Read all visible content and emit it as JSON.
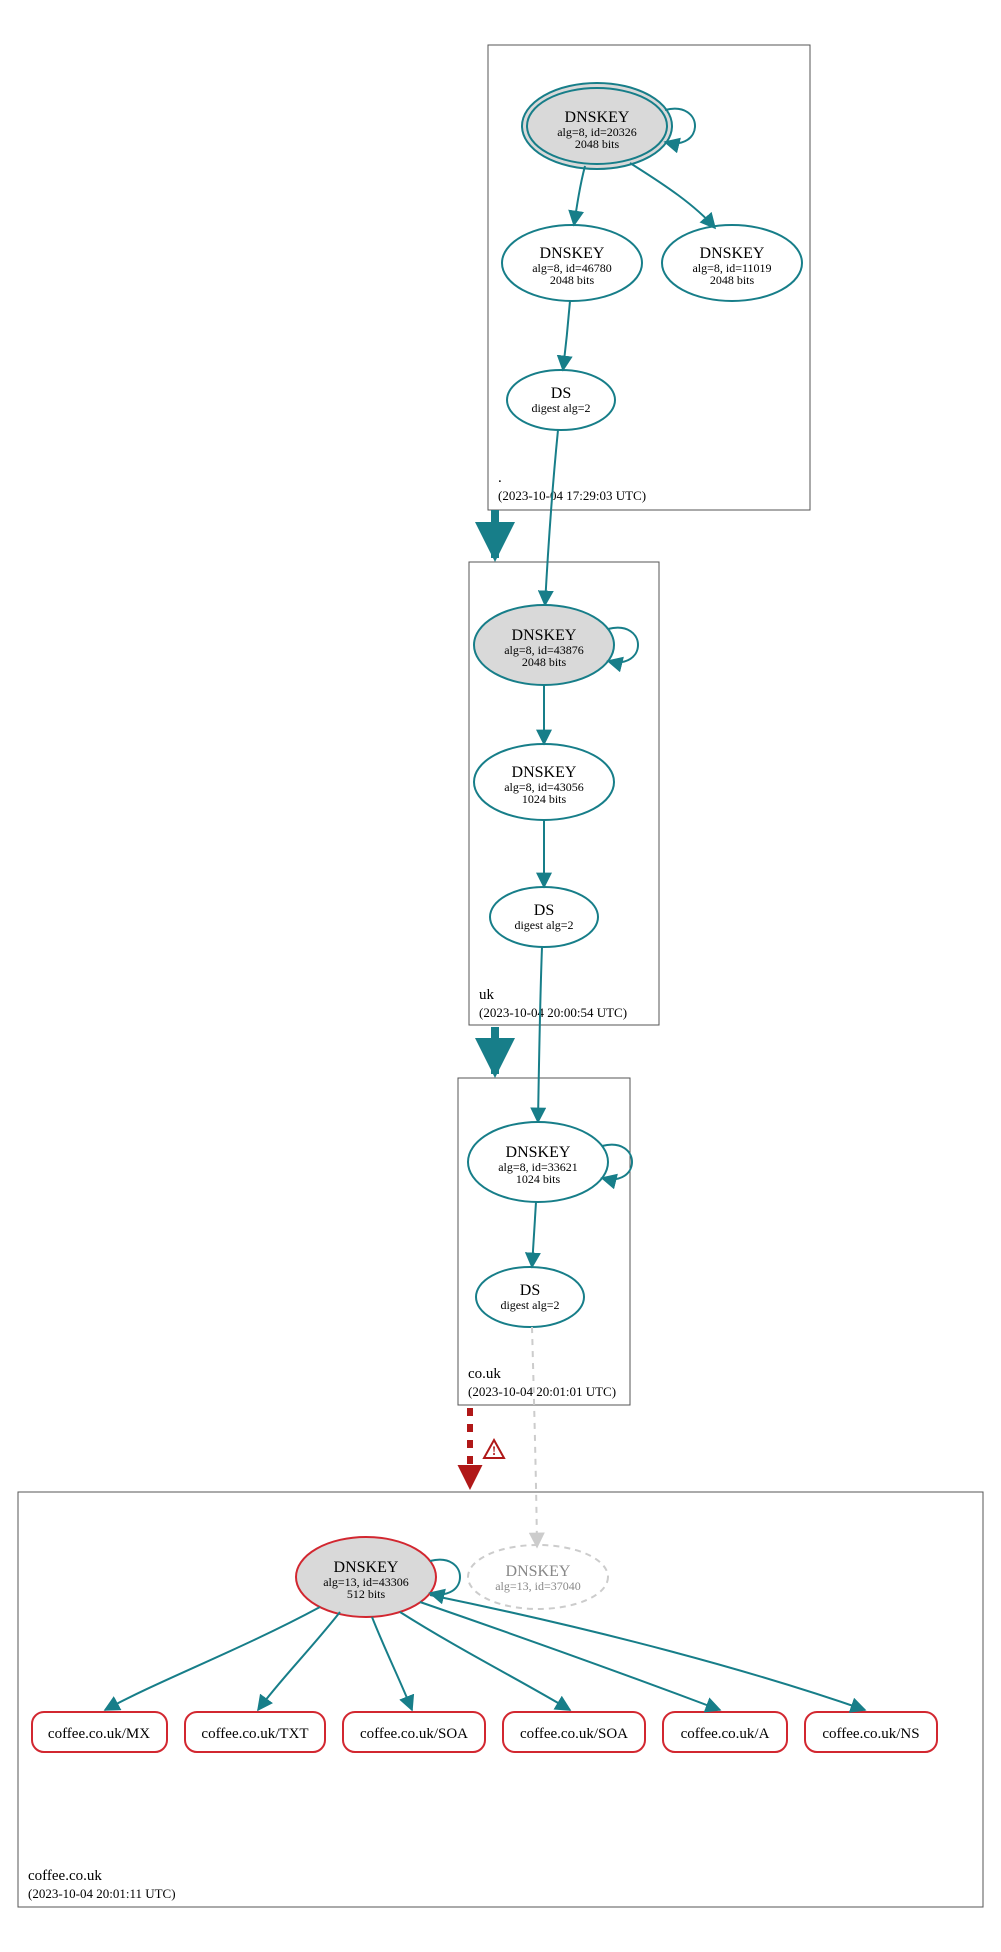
{
  "colors": {
    "teal": "#177e89",
    "red": "#d22730",
    "gray": "#cccccc",
    "fill_gray": "#d9d9d9"
  },
  "zones": {
    "root": {
      "name": ".",
      "timestamp": "(2023-10-04 17:29:03 UTC)"
    },
    "uk": {
      "name": "uk",
      "timestamp": "(2023-10-04 20:00:54 UTC)"
    },
    "couk": {
      "name": "co.uk",
      "timestamp": "(2023-10-04 20:01:01 UTC)"
    },
    "coffee": {
      "name": "coffee.co.uk",
      "timestamp": "(2023-10-04 20:01:11 UTC)"
    }
  },
  "nodes": {
    "root_ksk": {
      "title": "DNSKEY",
      "line2": "alg=8, id=20326",
      "line3": "2048 bits"
    },
    "root_zsk1": {
      "title": "DNSKEY",
      "line2": "alg=8, id=46780",
      "line3": "2048 bits"
    },
    "root_zsk2": {
      "title": "DNSKEY",
      "line2": "alg=8, id=11019",
      "line3": "2048 bits"
    },
    "root_ds": {
      "title": "DS",
      "line2": "digest alg=2"
    },
    "uk_ksk": {
      "title": "DNSKEY",
      "line2": "alg=8, id=43876",
      "line3": "2048 bits"
    },
    "uk_zsk": {
      "title": "DNSKEY",
      "line2": "alg=8, id=43056",
      "line3": "1024 bits"
    },
    "uk_ds": {
      "title": "DS",
      "line2": "digest alg=2"
    },
    "couk_ksk": {
      "title": "DNSKEY",
      "line2": "alg=8, id=33621",
      "line3": "1024 bits"
    },
    "couk_ds": {
      "title": "DS",
      "line2": "digest alg=2"
    },
    "coffee_ksk": {
      "title": "DNSKEY",
      "line2": "alg=13, id=43306",
      "line3": "512 bits"
    },
    "coffee_gray": {
      "title": "DNSKEY",
      "line2": "alg=13, id=37040"
    },
    "rr_mx": {
      "label": "coffee.co.uk/MX"
    },
    "rr_txt": {
      "label": "coffee.co.uk/TXT"
    },
    "rr_soa1": {
      "label": "coffee.co.uk/SOA"
    },
    "rr_soa2": {
      "label": "coffee.co.uk/SOA"
    },
    "rr_a": {
      "label": "coffee.co.uk/A"
    },
    "rr_ns": {
      "label": "coffee.co.uk/NS"
    }
  }
}
